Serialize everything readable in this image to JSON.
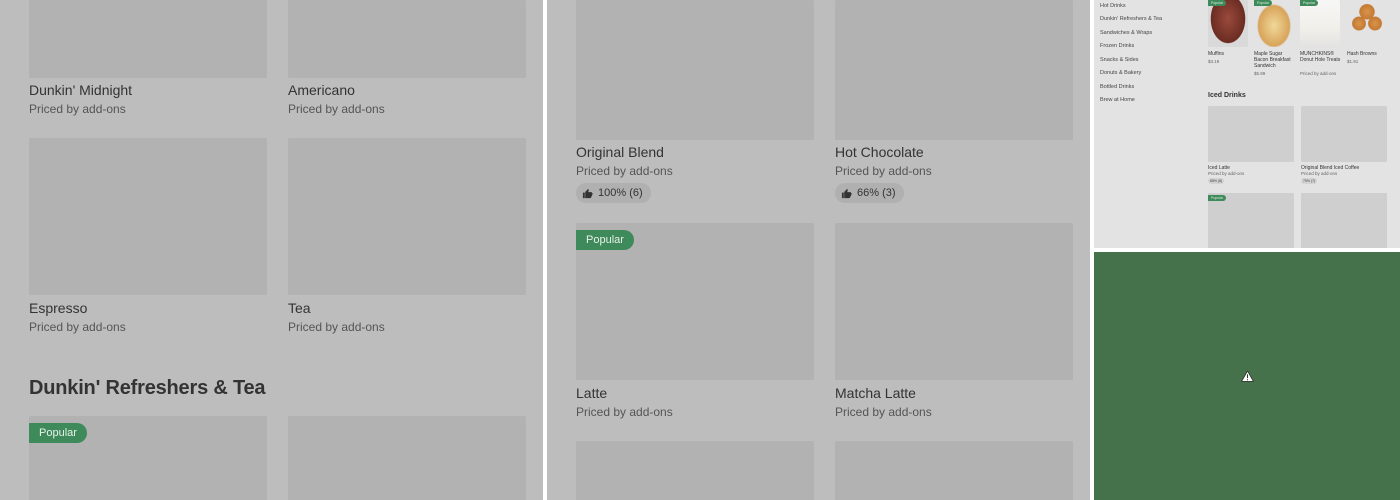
{
  "pane_a": {
    "items": [
      {
        "name": "Dunkin' Midnight",
        "price": "Priced by add-ons"
      },
      {
        "name": "Americano",
        "price": "Priced by add-ons"
      },
      {
        "name": "Espresso",
        "price": "Priced by add-ons"
      },
      {
        "name": "Tea",
        "price": "Priced by add-ons"
      }
    ],
    "section_title": "Dunkin' Refreshers & Tea",
    "badge": "Popular"
  },
  "pane_b": {
    "items": [
      {
        "name": "Original Blend",
        "price": "Priced by add-ons",
        "rating": "100% (6)"
      },
      {
        "name": "Hot Chocolate",
        "price": "Priced by add-ons",
        "rating": "66% (3)"
      },
      {
        "name": "Latte",
        "price": "Priced by add-ons"
      },
      {
        "name": "Matcha Latte",
        "price": "Priced by add-ons"
      }
    ],
    "badge": "Popular"
  },
  "pane_c": {
    "categories": [
      "Hot Drinks",
      "Dunkin' Refreshers & Tea",
      "Sandwiches & Wraps",
      "Frozen Drinks",
      "Snacks & Sides",
      "Donuts & Bakery",
      "Bottled Drinks",
      "Brew at Home"
    ],
    "top_items": [
      {
        "name": "Muffins",
        "price": "$3.19"
      },
      {
        "name": "Maple Sugar Bacon Breakfast Sandwich",
        "price": "$5.99"
      },
      {
        "name": "MUNCHKINS® Donut Hole Treats",
        "price": "Priced by add-ons"
      },
      {
        "name": "Hash Browns",
        "price": "$1.91"
      }
    ],
    "section_title": "Iced Drinks",
    "iced_items": [
      {
        "name": "Iced Latte",
        "price": "Priced by add-ons",
        "rating": "88% (8)"
      },
      {
        "name": "Original Blend Iced Coffee",
        "price": "Priced by add-ons",
        "rating": "75% (7)"
      }
    ],
    "badge": "Popular"
  },
  "pane_d": {
    "icon": "warning-icon",
    "background": "#46724b"
  }
}
